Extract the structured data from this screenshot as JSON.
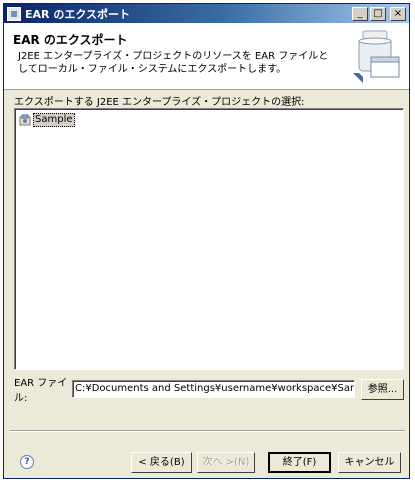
{
  "window": {
    "title": "EAR のエクスポート",
    "controls": {
      "minimize": "_",
      "maximize": "□",
      "close": "×"
    }
  },
  "header": {
    "title": "EAR のエクスポート",
    "description": "J2EE エンタープライズ・プロジェクトのリソースを EAR ファイルとしてローカル・ファイル・システムにエクスポートします。"
  },
  "projects": {
    "label": "エクスポートする J2EE エンタープライズ・プロジェクトの選択:",
    "items": [
      {
        "label": "Sample",
        "icon": "ear-project-icon",
        "selected": true
      }
    ]
  },
  "ear_file": {
    "label": "EAR ファイル:",
    "value": "C:¥Documents and Settings¥username¥workspace¥Sample¥Samp",
    "browse_label": "参照..."
  },
  "buttons": {
    "help": "?",
    "back": "< 戻る(B)",
    "next": "次へ >(N)",
    "finish": "終了(F)",
    "cancel": "キャンセル",
    "next_enabled": false
  },
  "colors": {
    "titlebar_start": "#0a246a",
    "titlebar_end": "#a6caf0",
    "dialog_bg": "#ece9d8"
  }
}
